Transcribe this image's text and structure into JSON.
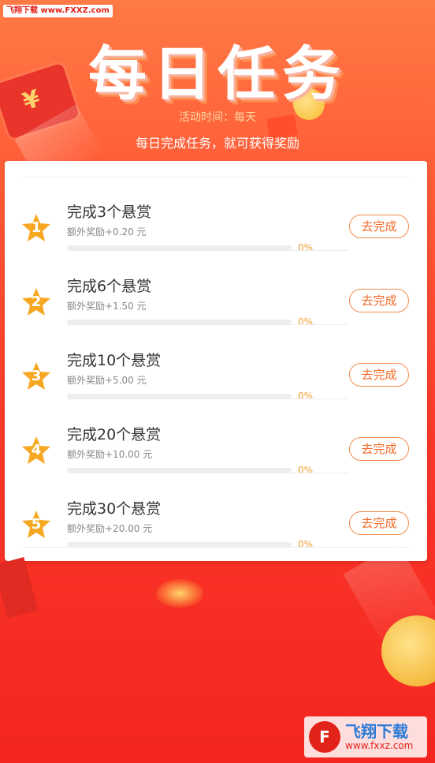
{
  "watermark": "飞翔下载 www.FXXZ.com",
  "header": {
    "title": "每日任务",
    "activity_time": "活动时间：每天",
    "subtitle": "每日完成任务，就可获得奖励"
  },
  "colors": {
    "accent": "#ff9a2f",
    "button_border": "#f28a4d",
    "button_text": "#f06a2a",
    "star": "#f7a823"
  },
  "tasks": [
    {
      "rank": "1",
      "title": "完成3个悬赏",
      "reward": "额外奖励+0.20 元",
      "progress_pct": "0%",
      "progress": 0,
      "button": "去完成"
    },
    {
      "rank": "2",
      "title": "完成6个悬赏",
      "reward": "额外奖励+1.50 元",
      "progress_pct": "0%",
      "progress": 0,
      "button": "去完成"
    },
    {
      "rank": "3",
      "title": "完成10个悬赏",
      "reward": "额外奖励+5.00 元",
      "progress_pct": "0%",
      "progress": 0,
      "button": "去完成"
    },
    {
      "rank": "4",
      "title": "完成20个悬赏",
      "reward": "额外奖励+10.00 元",
      "progress_pct": "0%",
      "progress": 0,
      "button": "去完成"
    },
    {
      "rank": "5",
      "title": "完成30个悬赏",
      "reward": "额外奖励+20.00 元",
      "progress_pct": "0%",
      "progress": 0,
      "button": "去完成"
    }
  ],
  "brand": {
    "logo_glyph": "F",
    "name": "飞翔下载",
    "url": "www.fxxz.com"
  },
  "icons": [
    "star-icon",
    "red-envelope-icon",
    "coin-icon"
  ]
}
